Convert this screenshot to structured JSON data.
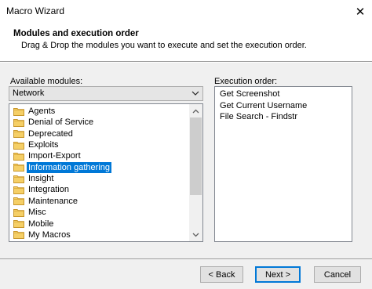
{
  "window": {
    "title": "Macro Wizard"
  },
  "header": {
    "title": "Modules and execution order",
    "subtitle": "Drag & Drop the modules you want to execute and set the execution order."
  },
  "available": {
    "label": "Available modules:",
    "selected_category": "Network",
    "items": [
      "Agents",
      "Denial of Service",
      "Deprecated",
      "Exploits",
      "Import-Export",
      "Information gathering",
      "Insight",
      "Integration",
      "Maintenance",
      "Misc",
      "Mobile",
      "My Macros"
    ],
    "selected_item": "Information gathering"
  },
  "execution": {
    "label": "Execution order:",
    "items": [
      "Get Screenshot",
      "Get Current Username",
      "File Search - Findstr"
    ]
  },
  "buttons": {
    "back": "< Back",
    "next": "Next >",
    "cancel": "Cancel"
  },
  "colors": {
    "selection": "#0078d7",
    "folder": "#e8b84a"
  }
}
